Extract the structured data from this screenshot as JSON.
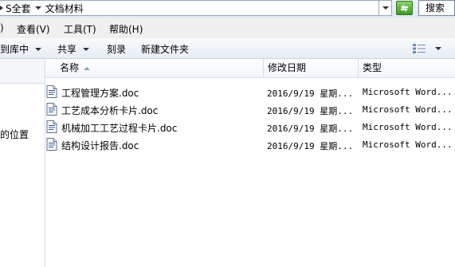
{
  "address_bar": {
    "crumbs": [
      "S全套",
      "文档材料"
    ],
    "leading_chevron": "›",
    "search_placeholder": "搜索"
  },
  "menu": {
    "items": [
      {
        "label": ")"
      },
      {
        "label": "查看(V)"
      },
      {
        "label": "工具(T)"
      },
      {
        "label": "帮助(H)"
      }
    ]
  },
  "toolbar": {
    "include_library": "到库中",
    "share": "共享",
    "burn": "刻录",
    "new_folder": "新建文件夹"
  },
  "nav": {
    "partial_text": "的位置"
  },
  "columns": {
    "name": "名称",
    "date": "修改日期",
    "type": "类型"
  },
  "files": [
    {
      "name": "工程管理方案.doc",
      "date": "2016/9/19 星期...",
      "type": "Microsoft Word..."
    },
    {
      "name": "工艺成本分析卡片.doc",
      "date": "2016/9/19 星期...",
      "type": "Microsoft Word..."
    },
    {
      "name": "机械加工工艺过程卡片.doc",
      "date": "2016/9/19 星期...",
      "type": "Microsoft Word..."
    },
    {
      "name": "结构设计报告.doc",
      "date": "2016/9/19 星期...",
      "type": "Microsoft Word..."
    }
  ],
  "icons": {
    "file": "word-doc-icon",
    "refresh": "refresh-icon",
    "view": "view-options-icon"
  }
}
